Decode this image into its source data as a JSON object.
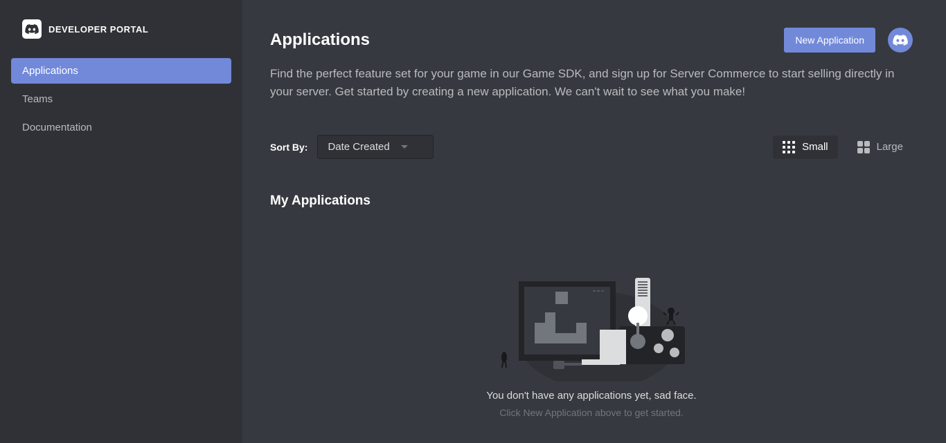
{
  "header": {
    "portal_title": "DEVELOPER PORTAL"
  },
  "sidebar": {
    "items": [
      {
        "label": "Applications",
        "active": true
      },
      {
        "label": "Teams",
        "active": false
      },
      {
        "label": "Documentation",
        "active": false
      }
    ]
  },
  "page": {
    "title": "Applications",
    "description": "Find the perfect feature set for your game in our Game SDK, and sign up for Server Commerce to start selling directly in your server. Get started by creating a new application. We can't wait to see what you make!",
    "new_button": "New Application"
  },
  "controls": {
    "sort_label": "Sort By:",
    "sort_value": "Date Created",
    "view_small": "Small",
    "view_large": "Large",
    "view_active": "Small"
  },
  "section": {
    "title": "My Applications"
  },
  "empty": {
    "message": "You don't have any applications yet, sad face.",
    "hint": "Click New Application above to get started."
  },
  "colors": {
    "accent": "#7289da",
    "bg_main": "#36393f",
    "bg_sidebar": "#2f3136"
  }
}
